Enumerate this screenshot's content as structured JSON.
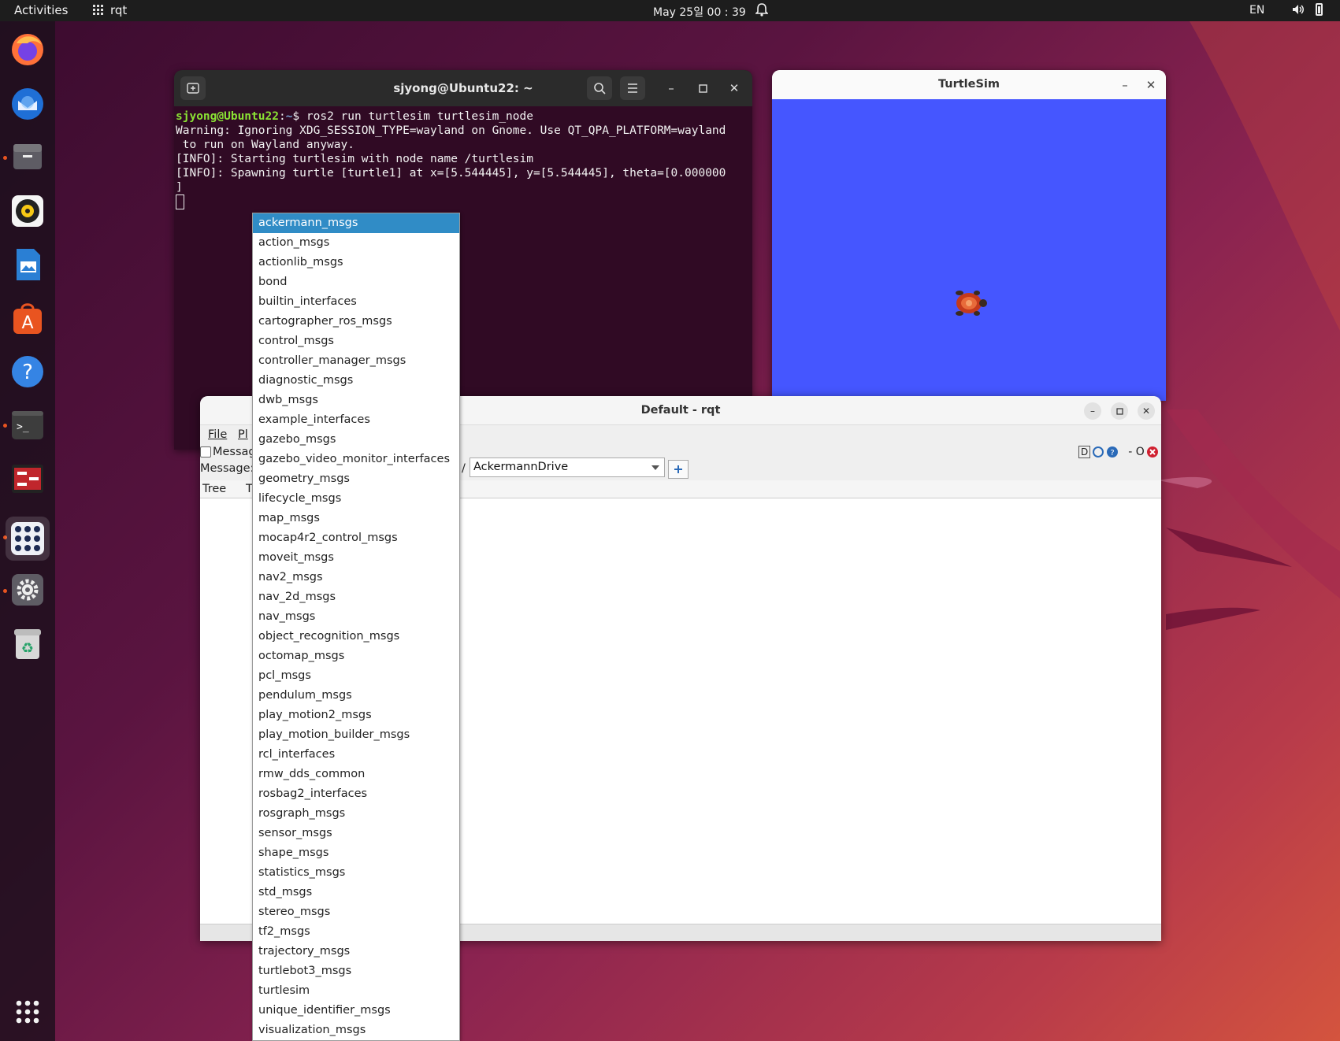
{
  "topbar": {
    "activities": "Activities",
    "app_name": "rqt",
    "clock": "May 25일  00 : 39",
    "lang": "EN"
  },
  "dock": {
    "icons": [
      "firefox-icon",
      "thunderbird-icon",
      "files-icon",
      "rhythmbox-icon",
      "writer-icon",
      "app-center-icon",
      "help-icon",
      "terminal-icon",
      "rqt-icon",
      "show-apps-icon",
      "settings-icon",
      "trash-icon",
      "app-grid-icon"
    ]
  },
  "terminal": {
    "title": "sjyong@Ubuntu22: ~",
    "prompt_user": "sjyong@Ubuntu22",
    "prompt_path": "~",
    "command": "$ ros2 run turtlesim turtlesim_node",
    "lines": [
      "Warning: Ignoring XDG_SESSION_TYPE=wayland on Gnome. Use QT_QPA_PLATFORM=wayland",
      " to run on Wayland anyway.",
      "[INFO]: Starting turtlesim with node name /turtlesim",
      "[INFO]: Spawning turtle [turtle1] at x=[5.544445], y=[5.544445], theta=[0.000000",
      "]"
    ]
  },
  "turtlesim": {
    "title": "TurtleSim",
    "background": "#4556ff"
  },
  "rqt": {
    "title": "Default - rqt",
    "menu_file": "File",
    "menu_plugins": "Pl",
    "plugin_tab": "Messag",
    "message_label": "Message:",
    "slash": "/",
    "type_value": "AckermannDrive",
    "col_tree": "Tree",
    "col_type": "T",
    "corner_text": "D",
    "corner_dash": "- O"
  },
  "dropdown": {
    "selected": "ackermann_msgs",
    "items": [
      "ackermann_msgs",
      "action_msgs",
      "actionlib_msgs",
      "bond",
      "builtin_interfaces",
      "cartographer_ros_msgs",
      "control_msgs",
      "controller_manager_msgs",
      "diagnostic_msgs",
      "dwb_msgs",
      "example_interfaces",
      "gazebo_msgs",
      "gazebo_video_monitor_interfaces",
      "geometry_msgs",
      "lifecycle_msgs",
      "map_msgs",
      "mocap4r2_control_msgs",
      "moveit_msgs",
      "nav2_msgs",
      "nav_2d_msgs",
      "nav_msgs",
      "object_recognition_msgs",
      "octomap_msgs",
      "pcl_msgs",
      "pendulum_msgs",
      "play_motion2_msgs",
      "play_motion_builder_msgs",
      "rcl_interfaces",
      "rmw_dds_common",
      "rosbag2_interfaces",
      "rosgraph_msgs",
      "sensor_msgs",
      "shape_msgs",
      "statistics_msgs",
      "std_msgs",
      "stereo_msgs",
      "tf2_msgs",
      "trajectory_msgs",
      "turtlebot3_msgs",
      "turtlesim",
      "unique_identifier_msgs",
      "visualization_msgs"
    ],
    "highlight_color": "#308cc6"
  }
}
